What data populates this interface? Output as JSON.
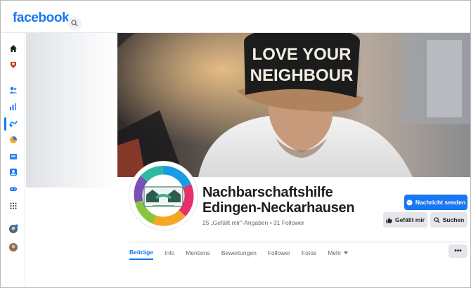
{
  "header": {
    "brand": "facebook",
    "search_icon": "search-icon",
    "brand_color": "#1877f2"
  },
  "left_rail": {
    "icons": [
      "home-icon",
      "watch-icon",
      "friends-icon",
      "insights-icon",
      "creator-icon",
      "ads-icon",
      "shop-icon",
      "groups-icon",
      "gaming-icon",
      "menu-grid-icon",
      "profile-avatar-icon",
      "account-avatar-icon"
    ]
  },
  "cover": {
    "cap_line1": "LOVE YOUR",
    "cap_line2": "NEIGHBOUR"
  },
  "page": {
    "title_line1": "Nachbarschaftshilfe",
    "title_line2": "Edingen-Neckarhausen",
    "meta": "25 „Gefällt mir\"-Angaben • 31 Follower"
  },
  "actions": {
    "message_label": "Nachricht senden",
    "like_label": "Gefällt mir",
    "search_label": "Suchen",
    "primary_color": "#1877f2"
  },
  "tabs": {
    "items": [
      {
        "label": "Beiträge",
        "active": true
      },
      {
        "label": "Info",
        "active": false
      },
      {
        "label": "Mentions",
        "active": false
      },
      {
        "label": "Bewertungen",
        "active": false
      },
      {
        "label": "Follower",
        "active": false
      },
      {
        "label": "Fotos",
        "active": false
      },
      {
        "label": "Mehr",
        "active": false
      }
    ],
    "overflow_label": "•••"
  }
}
